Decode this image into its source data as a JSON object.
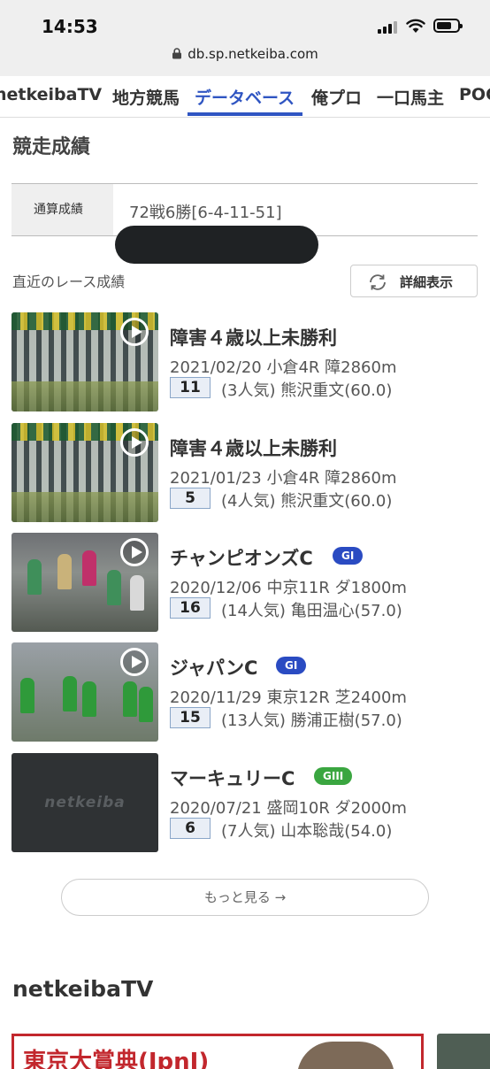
{
  "status_bar": {
    "time": "14:53"
  },
  "browser": {
    "url": "db.sp.netkeiba.com"
  },
  "nav": {
    "tabs": [
      {
        "label": "netkeibaTV"
      },
      {
        "label": "地方競馬"
      },
      {
        "label": "データベース"
      },
      {
        "label": "俺プロ"
      },
      {
        "label": "一口馬主"
      },
      {
        "label": "POG"
      }
    ],
    "active_index": 2
  },
  "race_results": {
    "title": "競走成績",
    "summary_label": "通算成績",
    "summary_value": "72戦6勝[6-4-11-51]",
    "recent_label": "直近のレース成績",
    "detail_button": "詳細表示"
  },
  "races": [
    {
      "name": "障害４歳以上未勝利",
      "grade": "",
      "meta": "2021/02/20 小倉4R 障2860m",
      "finish": "11",
      "jockey_line": "(3人気) 熊沢重文(60.0)",
      "thumb": "video"
    },
    {
      "name": "障害４歳以上未勝利",
      "grade": "",
      "meta": "2021/01/23 小倉4R 障2860m",
      "finish": "5",
      "jockey_line": "(4人気) 熊沢重文(60.0)",
      "thumb": "video"
    },
    {
      "name": "チャンピオンズC",
      "grade": "GI",
      "meta": "2020/12/06 中京11R ダ1800m",
      "finish": "16",
      "jockey_line": "(14人気) 亀田温心(57.0)",
      "thumb": "video"
    },
    {
      "name": "ジャパンC",
      "grade": "GI",
      "meta": "2020/11/29 東京12R 芝2400m",
      "finish": "15",
      "jockey_line": "(13人気) 勝浦正樹(57.0)",
      "thumb": "video"
    },
    {
      "name": "マーキュリーC",
      "grade": "GIII",
      "meta": "2020/07/21 盛岡10R ダ2000m",
      "finish": "6",
      "jockey_line": "(7人気) 山本聡哉(54.0)",
      "thumb": "placeholder",
      "placeholder_logo": "netkeiba"
    }
  ],
  "more_button": "もっと見る →",
  "tv_section": {
    "title": "netkeibaTV",
    "card_headline": "東京大賞典(JpnⅠ)"
  },
  "colors": {
    "accent": "#2f55c2",
    "g1": "#2a4bc2",
    "g3": "#3aa640",
    "finish_bg": "#e9eef6"
  }
}
